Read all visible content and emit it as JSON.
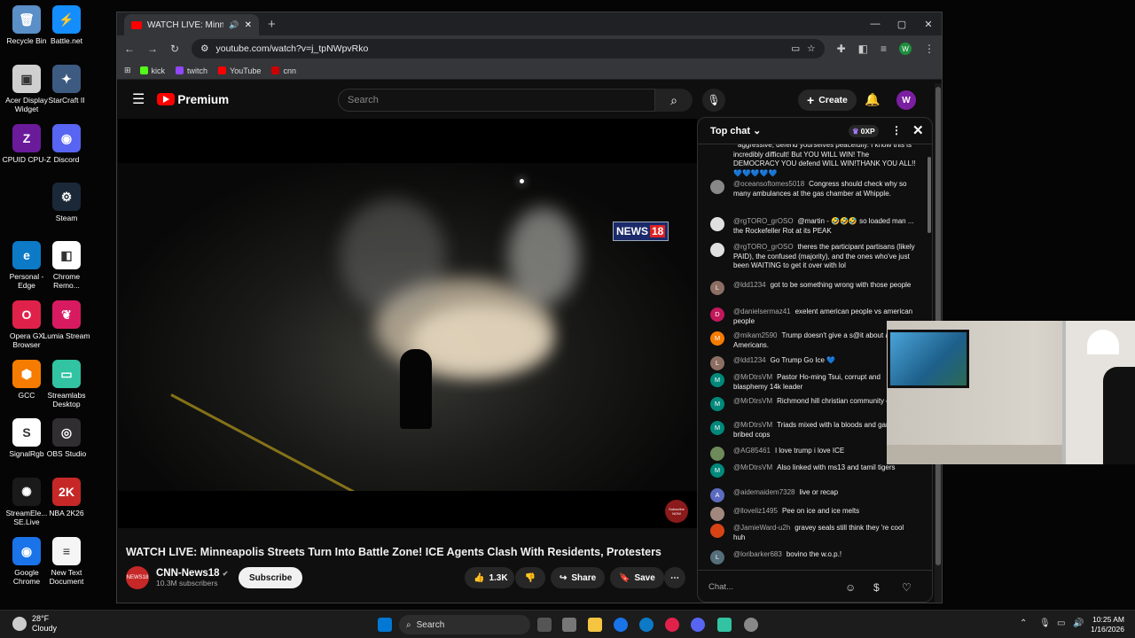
{
  "desktop_icons": [
    {
      "label": "Recycle Bin",
      "color": "#5a8fc8",
      "glyph": "🗑"
    },
    {
      "label": "Battle.net",
      "color": "#148eff",
      "glyph": "⚡"
    },
    {
      "label": "Acer Display Widget",
      "color": "#cfcfcf",
      "glyph": "▣"
    },
    {
      "label": "StarCraft II",
      "color": "#3d5a80",
      "glyph": "✦"
    },
    {
      "label": "CPUID CPU-Z",
      "color": "#6a1b9a",
      "glyph": "Z"
    },
    {
      "label": "Discord",
      "color": "#5865f2",
      "glyph": "◉"
    },
    {
      "label": "Steam",
      "color": "#1b2838",
      "glyph": "⚙"
    },
    {
      "label": "Personal - Edge",
      "color": "#0c7ac7",
      "glyph": "e"
    },
    {
      "label": "Chrome Remo...",
      "color": "#ffffff",
      "glyph": "◧"
    },
    {
      "label": "Opera GX Browser",
      "color": "#e0224a",
      "glyph": "O"
    },
    {
      "label": "Lumia Stream",
      "color": "#d81b60",
      "glyph": "❦"
    },
    {
      "label": "GCC",
      "color": "#f57c00",
      "glyph": "⬢"
    },
    {
      "label": "Streamlabs Desktop",
      "color": "#31c3a2",
      "glyph": "▭"
    },
    {
      "label": "SignalRgb",
      "color": "#ffffff",
      "glyph": "S"
    },
    {
      "label": "OBS Studio",
      "color": "#302e31",
      "glyph": "◎"
    },
    {
      "label": "StreamEle... SE.Live",
      "color": "#1a1a1a",
      "glyph": "✺"
    },
    {
      "label": "NBA 2K26",
      "color": "#c62828",
      "glyph": "2K"
    },
    {
      "label": "Google Chrome",
      "color": "#1a73e8",
      "glyph": "◉"
    },
    {
      "label": "New Text Document",
      "color": "#f5f5f5",
      "glyph": "≡"
    }
  ],
  "browser": {
    "tab_title": "WATCH LIVE: Minneapolis S",
    "url": "youtube.com/watch?v=j_tpNWpvRko",
    "bookmarks": [
      {
        "label": "kick",
        "color": "#53fc18"
      },
      {
        "label": "twitch",
        "color": "#9146ff"
      },
      {
        "label": "YouTube",
        "color": "#ff0000"
      },
      {
        "label": "cnn",
        "color": "#cc0000"
      }
    ],
    "profile_initial": "W"
  },
  "youtube": {
    "brand": "Premium",
    "search_placeholder": "Search",
    "create_label": "Create",
    "avatar_initial": "W",
    "video_title": "WATCH LIVE: Minneapolis Streets Turn Into Battle Zone! ICE Agents Clash With Residents, Protesters",
    "channel_name": "CNN-News18",
    "channel_avatar_text": "NEWS18",
    "subscribers": "10.3M subscribers",
    "subscribe_label": "Subscribe",
    "likes": "1.3K",
    "share_label": "Share",
    "save_label": "Save",
    "overlay_logo": "NEWS",
    "overlay_logo_num": "18",
    "watermark": "Subscribe NOW"
  },
  "chat": {
    "mode": "Top chat",
    "xp": "0XP",
    "input_placeholder": "Chat...",
    "messages": [
      {
        "author": "",
        "text": "aggressive, defend yourselves peacefully. I know this is incredibly difficult! But YOU WILL WIN! The DEMOCRACY YOU defend WILL WIN!THANK YOU ALL!! 💙💙💙💙💙",
        "initial": "",
        "color": "#c2185b"
      },
      {
        "author": "@oceansoftomes5018",
        "text": "Congress should check why so many ambulances at the gas chamber at Whipple.",
        "initial": "",
        "color": "#888888"
      },
      {
        "author": "@rgTORO_grOSO",
        "text": "@martin - 🤣🤣🤣 so loaded man ... the Rockefeller Rot at its PEAK",
        "initial": "",
        "color": "#e0e0e0"
      },
      {
        "author": "@rgTORO_grOSO",
        "text": "theres the participant partisans (likely PAID), the confused (majority), and the ones who've just been WAITING to get it over with lol",
        "initial": "",
        "color": "#e0e0e0"
      },
      {
        "author": "@ldd1234",
        "text": "got to be something wrong with those people",
        "initial": "L",
        "color": "#8d6e63"
      },
      {
        "author": "@danielsermaz41",
        "text": "exelent american people vs american people",
        "initial": "D",
        "color": "#c2185b"
      },
      {
        "author": "@mikam2590",
        "text": "Trump doesn't give a s@it about average Americans.",
        "initial": "M",
        "color": "#f57c00"
      },
      {
        "author": "@ldd1234",
        "text": "Go Trump Go Ice 💙",
        "initial": "L",
        "color": "#8d6e63"
      },
      {
        "author": "@MrDtrsVM",
        "text": "Pastor Ho-ming Tsui, corrupt and blasphemy 14k leader",
        "initial": "M",
        "color": "#00897b"
      },
      {
        "author": "@MrDtrsVM",
        "text": "Richmond hill christian community church",
        "initial": "M",
        "color": "#00897b"
      },
      {
        "author": "@MrDtrsVM",
        "text": "Triads mixed with la bloods and gangs and bribed cops",
        "initial": "M",
        "color": "#00897b"
      },
      {
        "author": "@AG85461",
        "text": "I love trump i love ICE",
        "initial": "",
        "color": "#6d8b5a"
      },
      {
        "author": "@MrDtrsVM",
        "text": "Also linked with ms13 and tamil tigers",
        "initial": "M",
        "color": "#00897b"
      },
      {
        "author": "@aidemaidem7328",
        "text": "live or recap",
        "initial": "A",
        "color": "#5c6bc0"
      },
      {
        "author": "@lloveliz1495",
        "text": "Pee on ice and ice melts",
        "initial": "",
        "color": "#a1887f"
      },
      {
        "author": "@JamieWard-u2h",
        "text": "gravey seals still think they 're cool huh",
        "initial": "",
        "color": "#d84315"
      },
      {
        "author": "@loribarker683",
        "text": "bovino the w.o.p.!",
        "initial": "L",
        "color": "#546e7a"
      }
    ]
  },
  "taskbar": {
    "temperature": "28°F",
    "condition": "Cloudy",
    "search_label": "Search",
    "time": "10:25 AM",
    "date": "1/16/2026"
  }
}
